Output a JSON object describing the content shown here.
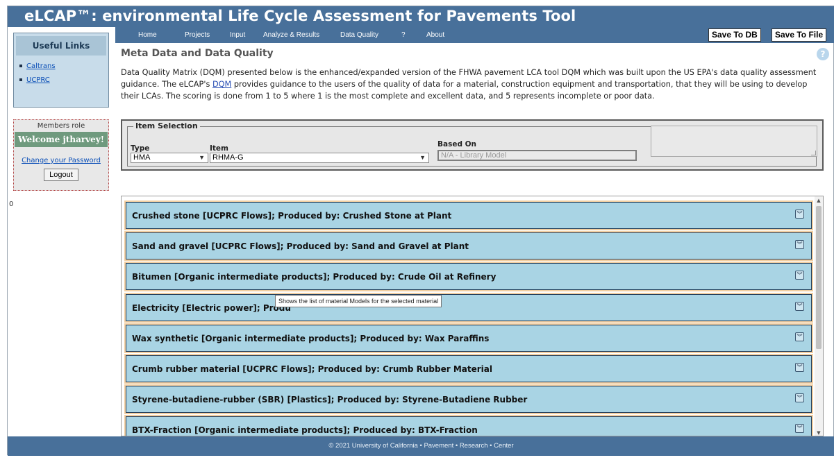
{
  "header": {
    "title": "eLCAP™: environmental Life Cycle Assessment for Pavements Tool"
  },
  "sidebar": {
    "useful_links_title": "Useful Links",
    "links": [
      "Caltrans",
      "UCPRC"
    ],
    "members_role": "Members role",
    "welcome": "Welcome jtharvey!",
    "change_password": "Change your Password",
    "logout": "Logout",
    "stray_text": "0"
  },
  "nav": {
    "items": [
      "Home",
      "Projects",
      "Input",
      "Analyze & Results",
      "Data Quality",
      "?",
      "About"
    ],
    "save_db": "Save To DB",
    "save_file": "Save To File",
    "help_icon_glyph": "?"
  },
  "main": {
    "title": "Meta Data and Data Quality",
    "intro_part1": "Data Quality Matrix (DQM) presented below is the enhanced/expanded version of the FHWA pavement LCA tool DQM which was built upon the US EPA's data quality assessment guidance. The eLCAP's ",
    "intro_link": "DQM",
    "intro_part2": " provides guidance to the users of the quality of data for a material, construction equipment and transportation, that they will be using to develop their LCAs. The scoring is done from 1 to 5 where 1 is the most complete and excellent data, and 5 represents incomplete or poor data."
  },
  "selection": {
    "legend": "Item Selection",
    "type_label": "Type",
    "type_value": "HMA",
    "item_label": "Item",
    "item_value": "RHMA-G",
    "based_on_label": "Based On",
    "based_on_placeholder": "N/A - Library Model"
  },
  "materials": [
    "Crushed stone [UCPRC Flows]; Produced by: Crushed Stone at Plant",
    "Sand and gravel [UCPRC Flows]; Produced by: Sand and Gravel at Plant",
    "Bitumen [Organic intermediate products]; Produced by: Crude Oil at Refinery",
    "Electricity [Electric power]; Produ",
    "Wax synthetic [Organic intermediate products]; Produced by: Wax Paraffins",
    "Crumb rubber material [UCPRC Flows]; Produced by: Crumb Rubber Material",
    "Styrene-butadiene-rubber (SBR) [Plastics]; Produced by: Styrene-Butadiene Rubber",
    "BTX-Fraction [Organic intermediate products]; Produced by: BTX-Fraction"
  ],
  "tooltip": "Shows the list of material Models for the selected material",
  "footer": {
    "text": "© 2021 University of California • Pavement • Research • Center"
  },
  "colors": {
    "header_bg": "#48709a",
    "accordion_bg": "#a9d4e4",
    "accordion_glow": "#f2cfa2",
    "welcome_bg": "#6f9a7e",
    "links_bg": "#c8dcea"
  }
}
